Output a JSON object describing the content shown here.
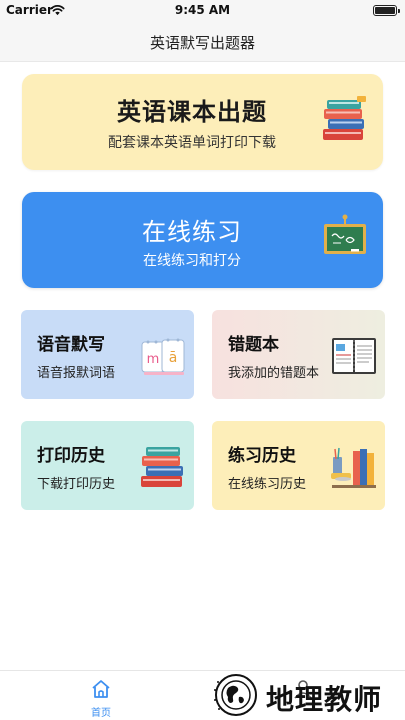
{
  "status_bar": {
    "carrier": "Carrier",
    "time": "9:45 AM"
  },
  "nav": {
    "title": "英语默写出题器"
  },
  "cards": {
    "textbook": {
      "title": "英语课本出题",
      "subtitle": "配套课本英语单词打印下载",
      "icon": "books-icon"
    },
    "practice": {
      "title": "在线练习",
      "subtitle": "在线练习和打分",
      "icon": "chalkboard-icon"
    },
    "dictation": {
      "title": "语音默写",
      "subtitle": "语音报默词语",
      "icon": "letter-cards-icon"
    },
    "wrongbook": {
      "title": "错题本",
      "subtitle": "我添加的错题本",
      "icon": "notebook-icon"
    },
    "print_history": {
      "title": "打印历史",
      "subtitle": "下载打印历史",
      "icon": "books-icon"
    },
    "practice_history": {
      "title": "练习历史",
      "subtitle": "在线练习历史",
      "icon": "study-desk-icon"
    }
  },
  "tab_bar": {
    "home_label": "首页",
    "active_color": "#3d8ff0"
  },
  "watermark": {
    "text": "地理教师"
  },
  "colors": {
    "textbook_bg": "#fdeeb9",
    "practice_bg": "#3d8ff0",
    "dictation_bg": "#c8dcf7",
    "print_history_bg": "#cbeee9"
  }
}
